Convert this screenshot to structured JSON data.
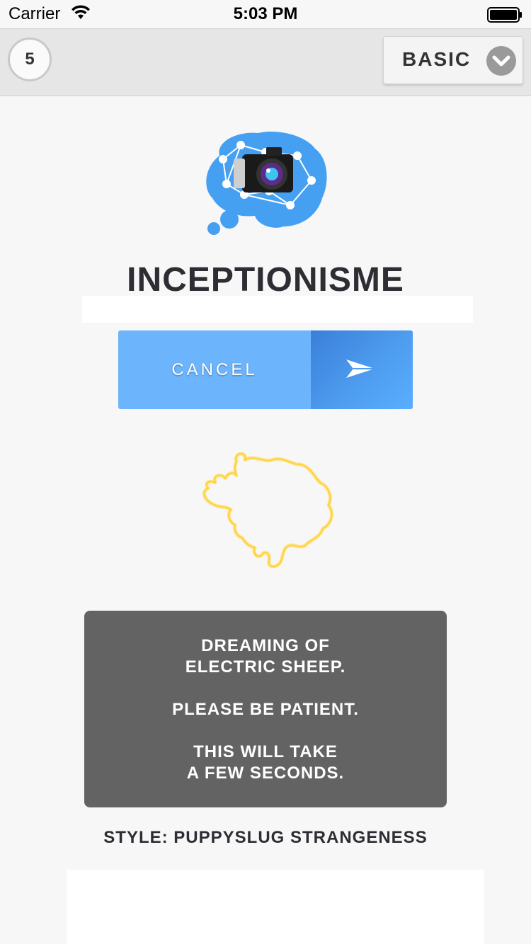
{
  "status_bar": {
    "carrier": "Carrier",
    "time": "5:03 PM"
  },
  "toolbar": {
    "counter": "5",
    "mode": "BASIC"
  },
  "app": {
    "title": "INCEPTIONISME"
  },
  "action": {
    "cancel_label": "CANCEL"
  },
  "message": {
    "lines": [
      "DREAMING OF",
      "ELECTRIC SHEEP.",
      "PLEASE BE PATIENT.",
      "THIS WILL TAKE",
      "A FEW SECONDS."
    ]
  },
  "style_label": "STYLE: PUPPYSLUG STRANGENESS",
  "colors": {
    "accent_blue": "#6cb4fb",
    "send_blue": "#4d9cef",
    "message_bg": "#636363",
    "sheep_outline": "#ffd84a"
  },
  "icons": {
    "wifi": "wifi-icon",
    "battery": "battery-icon",
    "chevron": "chevron-down-icon",
    "send": "send-icon",
    "logo": "brain-camera-logo",
    "sheep": "sheep-outline"
  }
}
